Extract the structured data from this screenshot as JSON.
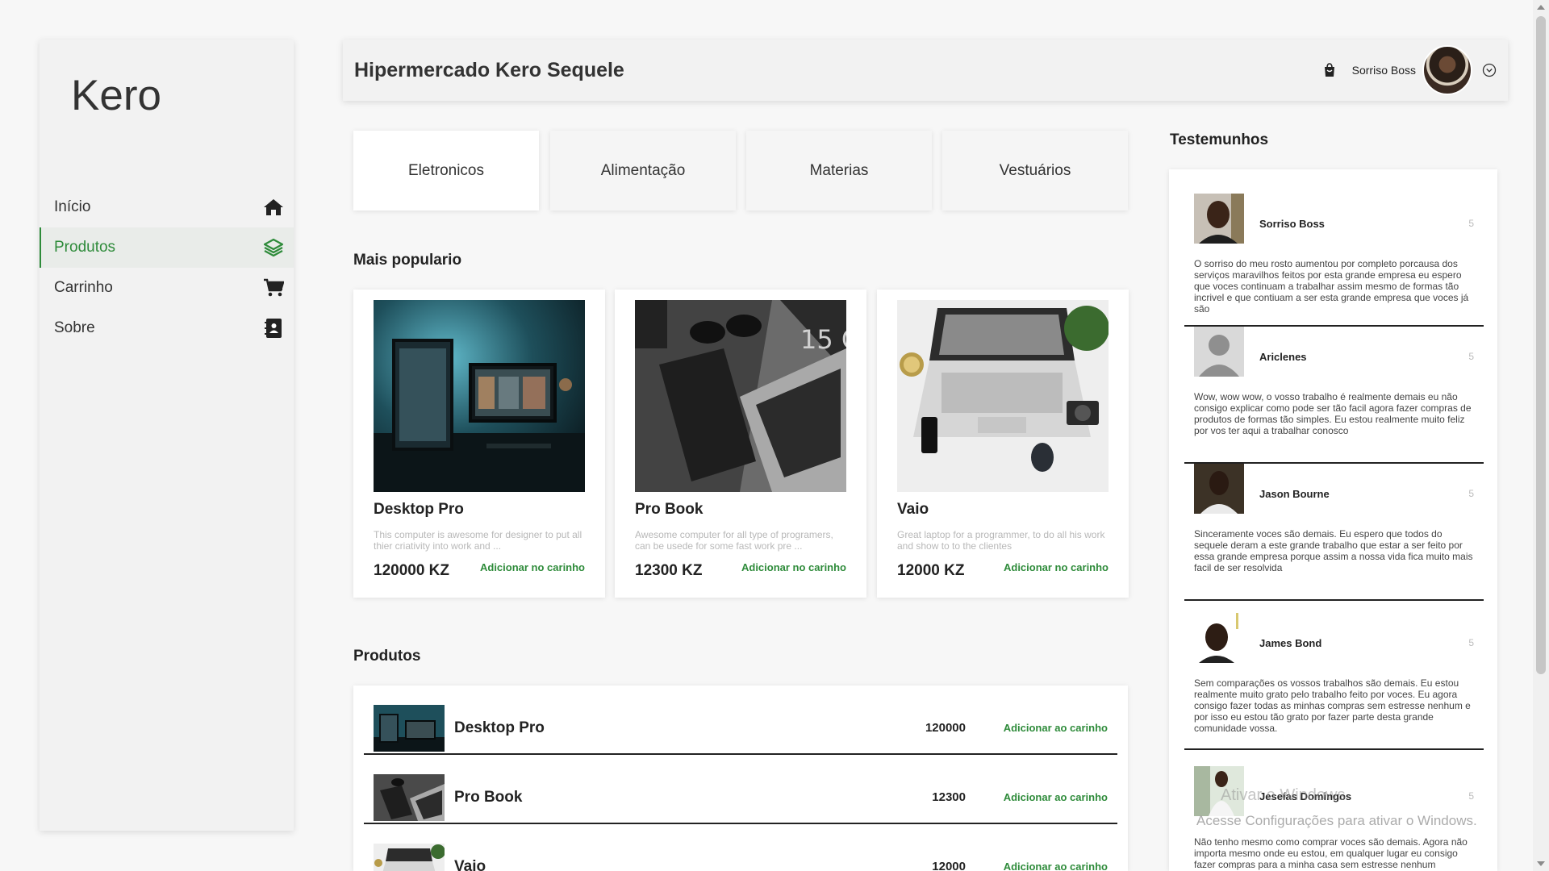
{
  "app": {
    "logo": "Kero",
    "accent_color": "#2e8b3a"
  },
  "sidebar": {
    "items": [
      {
        "label": "Início",
        "icon": "home-icon",
        "active": false
      },
      {
        "label": "Produtos",
        "icon": "layers-icon",
        "active": true
      },
      {
        "label": "Carrinho",
        "icon": "cart-icon",
        "active": false
      },
      {
        "label": "Sobre",
        "icon": "contact-book-icon",
        "active": false
      }
    ]
  },
  "header": {
    "title": "Hipermercado Kero Sequele",
    "user_name": "Sorriso Boss",
    "icons": [
      "shopping-bag-icon",
      "user-avatar",
      "chevron-down-circle-icon"
    ]
  },
  "categories": [
    {
      "label": "Eletronicos",
      "active": true
    },
    {
      "label": "Alimentação",
      "active": false
    },
    {
      "label": "Materias",
      "active": false
    },
    {
      "label": "Vestuários",
      "active": false
    }
  ],
  "popular": {
    "title": "Mais populario",
    "cards": [
      {
        "name": "Desktop Pro",
        "description": "This computer is awesome for designer to put all thier criativity into work and ...",
        "price": "120000 KZ",
        "add_label": "Adicionar no carinho"
      },
      {
        "name": "Pro Book",
        "description": "Awesome computer for all type of programers, can be usede for some fast work pre ...",
        "price": "12300 KZ",
        "add_label": "Adicionar no carinho"
      },
      {
        "name": "Vaio",
        "description": "Great laptop for a programmer, to do all his work and show to to the clientes",
        "price": "12000 KZ",
        "add_label": "Adicionar no carinho"
      }
    ]
  },
  "products": {
    "title": "Produtos",
    "rows": [
      {
        "name": "Desktop Pro",
        "price": "120000",
        "add_label": "Adicionar ao carinho"
      },
      {
        "name": "Pro Book",
        "price": "12300",
        "add_label": "Adicionar ao carinho"
      },
      {
        "name": "Vaio",
        "price": "12000",
        "add_label": "Adicionar ao carinho"
      }
    ]
  },
  "testimonials": {
    "title": "Testemunhos",
    "items": [
      {
        "name": "Sorriso Boss",
        "rating": "5",
        "text": "O sorriso do meu rosto aumentou por completo porcausa dos serviços maravilhos feitos por esta grande empresa eu espero que voces continuam a trabalhar assim mesmo de formas tão incrivel e que contiuam a ser esta grande empresa que voces já são"
      },
      {
        "name": "Ariclenes",
        "rating": "5",
        "text": "Wow, wow wow, o vosso trabalho é realmente demais eu não consigo explicar como pode ser tão facil agora fazer compras de produtos de formas tão simples. Eu estou realmente muito feliz por vos ter aqui a trabalhar conosco"
      },
      {
        "name": "Jason Bourne",
        "rating": "5",
        "text": "Sinceramente voces são demais. Eu espero que todos do sequele deram a este grande trabalho que estar a ser feito por essa grande empresa porque assim a nossa vida fica muito mais facil de ser resolvida"
      },
      {
        "name": "James Bond",
        "rating": "5",
        "text": "Sem comparações os vossos trabalhos são demais. Eu estou realmente muito grato pelo trabalho feito por voces. Eu agora consigo fazer todas as minhas compras sem estresse nenhum e por isso eu estou tão grato por fazer parte desta grande comunidade vossa."
      },
      {
        "name": "Jeseías Domingos",
        "rating": "5",
        "text": "Não tenho mesmo como comprar voces são demais. Agora não importa mesmo onde eu estou, em qualquer lugar eu consigo fazer compras para a minha casa sem estresse nenhum"
      }
    ]
  },
  "watermark": {
    "line1": "Ativar o Windows",
    "line2": "Acesse Configurações para ativar o Windows."
  }
}
